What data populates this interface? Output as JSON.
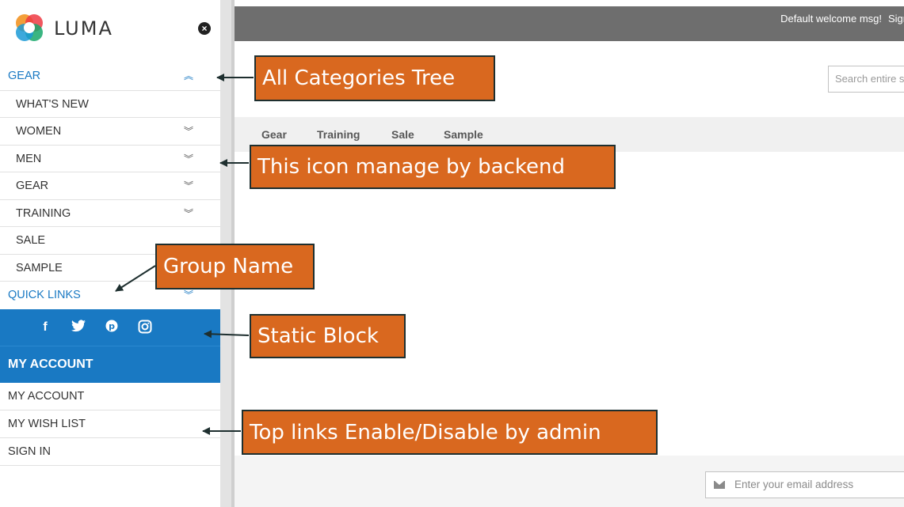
{
  "brand": {
    "name": "LUMA"
  },
  "topbar": {
    "welcome": "Default welcome msg!",
    "signin_partial": "Sign"
  },
  "search": {
    "placeholder": "Search entire store here..."
  },
  "nav": {
    "items": [
      "Gear",
      "Training",
      "Sale",
      "Sample"
    ]
  },
  "sidebar": {
    "categories_header": "GEAR",
    "items": [
      {
        "label": "WHAT'S NEW",
        "has_children": false
      },
      {
        "label": "WOMEN",
        "has_children": true
      },
      {
        "label": "MEN",
        "has_children": true
      },
      {
        "label": "GEAR",
        "has_children": true
      },
      {
        "label": "TRAINING",
        "has_children": true
      },
      {
        "label": "SALE",
        "has_children": false
      },
      {
        "label": "SAMPLE",
        "has_children": false
      }
    ],
    "quick_links": "QUICK LINKS",
    "social_icons": [
      "facebook-icon",
      "twitter-icon",
      "pinterest-icon",
      "instagram-icon"
    ],
    "my_account_header": "MY ACCOUNT",
    "account_links": [
      "MY ACCOUNT",
      "MY WISH LIST",
      "SIGN IN"
    ]
  },
  "footer": {
    "email_placeholder": "Enter your email address"
  },
  "annotations": {
    "all_categories": "All Categories Tree",
    "icon_backend": "This icon manage by backend",
    "group_name": "Group Name",
    "static_block": "Static Block",
    "top_links": "Top links Enable/Disable by admin"
  },
  "colors": {
    "accent": "#1979c3",
    "callout": "#d9681f",
    "topbar": "#6e6e6e"
  }
}
